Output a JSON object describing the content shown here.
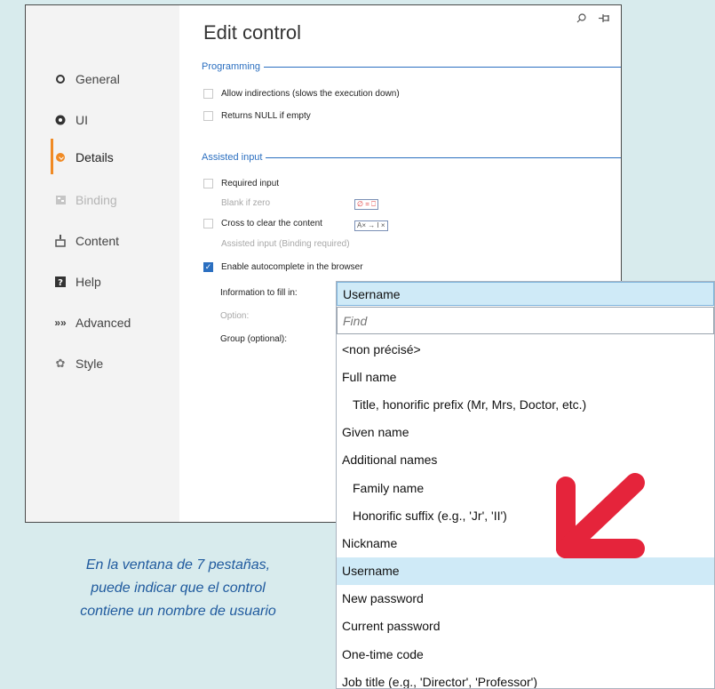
{
  "window": {
    "title": "Edit control",
    "search_icon": "⌕",
    "pin_icon": "†"
  },
  "sidebar": {
    "items": [
      {
        "label": "General",
        "icon": "circle-icon",
        "state": "normal"
      },
      {
        "label": "UI",
        "icon": "eye-icon",
        "state": "normal"
      },
      {
        "label": "Details",
        "icon": "check-circle-icon",
        "state": "active"
      },
      {
        "label": "Binding",
        "icon": "binding-icon",
        "state": "disabled"
      },
      {
        "label": "Content",
        "icon": "content-icon",
        "state": "normal"
      },
      {
        "label": "Help",
        "icon": "help-icon",
        "state": "normal"
      },
      {
        "label": "Advanced",
        "icon": "advanced-icon",
        "state": "normal"
      },
      {
        "label": "Style",
        "icon": "style-icon",
        "state": "normal"
      }
    ],
    "accent": "#f08a24"
  },
  "programming": {
    "heading": "Programming",
    "options": [
      {
        "label": "Allow indirections (slows the execution down)",
        "checked": false
      },
      {
        "label": "Returns NULL if empty",
        "checked": false
      }
    ]
  },
  "assisted": {
    "heading": "Assisted input",
    "required_input": "Required input",
    "blank_if_zero": "Blank if zero",
    "cross_to_clear": "Cross to clear the content",
    "assisted_binding": "Assisted input (Binding required)",
    "enable_autocomplete": "Enable autocomplete in the browser",
    "info_label": "Information to fill in:",
    "option_label": "Option:",
    "group_label": "Group (optional):",
    "mini_zero": "∅ = ⎕",
    "mini_cross": "A× → I ×"
  },
  "dropdown": {
    "selected": "Username",
    "find_placeholder": "Find",
    "items": [
      {
        "label": "<non précisé>",
        "indent": false,
        "highlight": false
      },
      {
        "label": "Full name",
        "indent": false,
        "highlight": false
      },
      {
        "label": "Title, honorific prefix (Mr, Mrs, Doctor, etc.)",
        "indent": true,
        "highlight": false
      },
      {
        "label": "Given name",
        "indent": false,
        "highlight": false
      },
      {
        "label": "Additional names",
        "indent": false,
        "highlight": false
      },
      {
        "label": "Family name",
        "indent": true,
        "highlight": false
      },
      {
        "label": "Honorific suffix (e.g., 'Jr', 'II')",
        "indent": true,
        "highlight": false
      },
      {
        "label": "Nickname",
        "indent": false,
        "highlight": false
      },
      {
        "label": "Username",
        "indent": false,
        "highlight": true
      },
      {
        "label": "New password",
        "indent": false,
        "highlight": false
      },
      {
        "label": "Current password",
        "indent": false,
        "highlight": false
      },
      {
        "label": "One-time code",
        "indent": false,
        "highlight": false
      },
      {
        "label": "Job title (e.g., 'Director', 'Professor')",
        "indent": false,
        "highlight": false
      }
    ]
  },
  "caption": {
    "line1": "En la ventana de 7 pestañas,",
    "line2": "puede indicar que el control",
    "line3": "contiene un nombre de usuario"
  },
  "colors": {
    "background": "#d8ebed",
    "accent_blue": "#2b6fc0",
    "highlight": "#cfeaf7",
    "arrow_red": "#e5243b"
  }
}
